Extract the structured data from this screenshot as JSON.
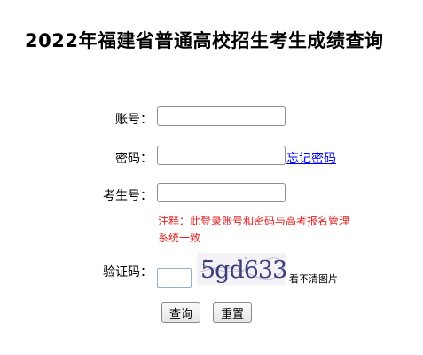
{
  "page": {
    "title": "2022年福建省普通高校招生考生成绩查询"
  },
  "form": {
    "account_label": "账号：",
    "account_value": "",
    "password_label": "密码：",
    "password_value": "",
    "forgot_password_link": "忘记密码",
    "exam_id_label": "考生号：",
    "exam_id_value": "",
    "note": "注释：此登录账号和密码与高考报名管理系统一致",
    "captcha_label": "验证码：",
    "captcha_value": "",
    "captcha_image_text": "5gd633",
    "captcha_refresh_label": "看不清图片",
    "query_button": "查询",
    "reset_button": "重置"
  },
  "colors": {
    "link": "#0000ee",
    "note": "#e02020",
    "captcha_text": "#3d3f7a"
  }
}
